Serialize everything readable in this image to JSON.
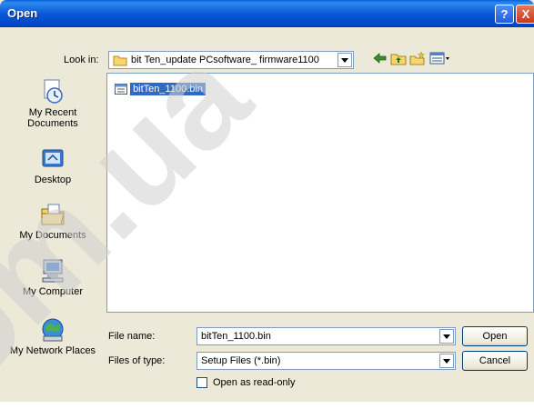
{
  "window": {
    "title": "Open",
    "help_glyph": "?",
    "close_glyph": "X"
  },
  "look_in": {
    "label": "Look in:",
    "value": "bit Ten_update PCsoftware_ firmware1100"
  },
  "toolbar": {
    "icons": [
      "back-icon",
      "up-folder-icon",
      "new-folder-icon",
      "views-menu-icon"
    ]
  },
  "places": [
    {
      "label": "My Recent Documents",
      "icon": "recent-documents-icon"
    },
    {
      "label": "Desktop",
      "icon": "desktop-icon"
    },
    {
      "label": "My Documents",
      "icon": "my-documents-icon"
    },
    {
      "label": "My Computer",
      "icon": "my-computer-icon"
    },
    {
      "label": "My Network Places",
      "icon": "network-places-icon"
    }
  ],
  "files": [
    {
      "name": "bitTen_1100.bin",
      "selected": true
    }
  ],
  "file_name": {
    "label": "File name:",
    "value": "bitTen_1100.bin"
  },
  "file_type": {
    "label": "Files of type:",
    "value": "Setup Files (*.bin)"
  },
  "read_only": {
    "label": "Open as read-only",
    "checked": false
  },
  "buttons": {
    "open": "Open",
    "cancel": "Cancel"
  },
  "watermark": {
    "text": "om.ua",
    "color": "#cfcfcf"
  },
  "colors": {
    "titlebar": "#0047c8",
    "selection": "#316ac5",
    "dialog_bg": "#ece9d8"
  }
}
